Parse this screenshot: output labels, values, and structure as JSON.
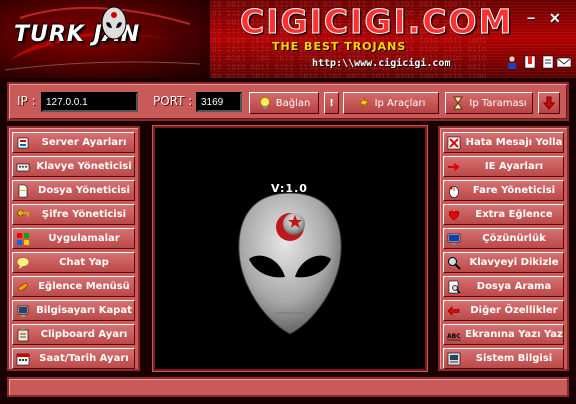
{
  "header": {
    "logo_text": "TURK JAN",
    "site_banner": "CIGICIGI.COM",
    "tagline": "THE BEST TROJANS",
    "url": "http:\\\\www.cigicigi.com",
    "minimize_label": "−",
    "close_label": "✕"
  },
  "connection": {
    "ip_label": "IP :",
    "ip_value": "127.0.0.1",
    "port_label": "PORT :",
    "port_value": "3169",
    "connect_label": "Bağlan",
    "warn_label": "!",
    "ip_tools_label": "Ip Araçları",
    "ip_scan_label": "Ip Taraması"
  },
  "left_menu": [
    {
      "label": "Server Ayarları",
      "icon": "settings-icon"
    },
    {
      "label": "Klavye Yöneticisi",
      "icon": "keyboard-icon"
    },
    {
      "label": "Dosya Yöneticisi",
      "icon": "file-icon"
    },
    {
      "label": "Şifre Yöneticisi",
      "icon": "key-icon"
    },
    {
      "label": "Uygulamalar",
      "icon": "apps-icon"
    },
    {
      "label": "Chat Yap",
      "icon": "chat-icon"
    },
    {
      "label": "Eğlence Menüsü",
      "icon": "fun-icon"
    },
    {
      "label": "Bilgisayarı Kapat",
      "icon": "shutdown-icon"
    },
    {
      "label": "Clipboard Ayarı",
      "icon": "clipboard-icon"
    },
    {
      "label": "Saat/Tarih Ayarı",
      "icon": "calendar-icon"
    }
  ],
  "right_menu": [
    {
      "label": "Hata Mesajı Yolla",
      "icon": "error-message-icon"
    },
    {
      "label": "IE Ayarları",
      "icon": "arrow-icon"
    },
    {
      "label": "Fare Yöneticisi",
      "icon": "mouse-icon"
    },
    {
      "label": "Extra Eğlence",
      "icon": "extra-fun-icon"
    },
    {
      "label": "Çözünürlük",
      "icon": "monitor-icon"
    },
    {
      "label": "Klavyeyi Dikizle",
      "icon": "magnifier-icon"
    },
    {
      "label": "Dosya Arama",
      "icon": "search-file-icon"
    },
    {
      "label": "Diğer Özellikler",
      "icon": "other-features-icon"
    },
    {
      "label": "Ekranına Yazı Yaz",
      "icon": "text-icon"
    },
    {
      "label": "Sistem Bilgisi",
      "icon": "system-info-icon"
    }
  ],
  "viewer": {
    "version": "V:1.0"
  },
  "status": {
    "text": ""
  },
  "colors": {
    "panel": "#c85a5a",
    "header_red": "#b00000",
    "accent_yellow": "#ffd700"
  }
}
